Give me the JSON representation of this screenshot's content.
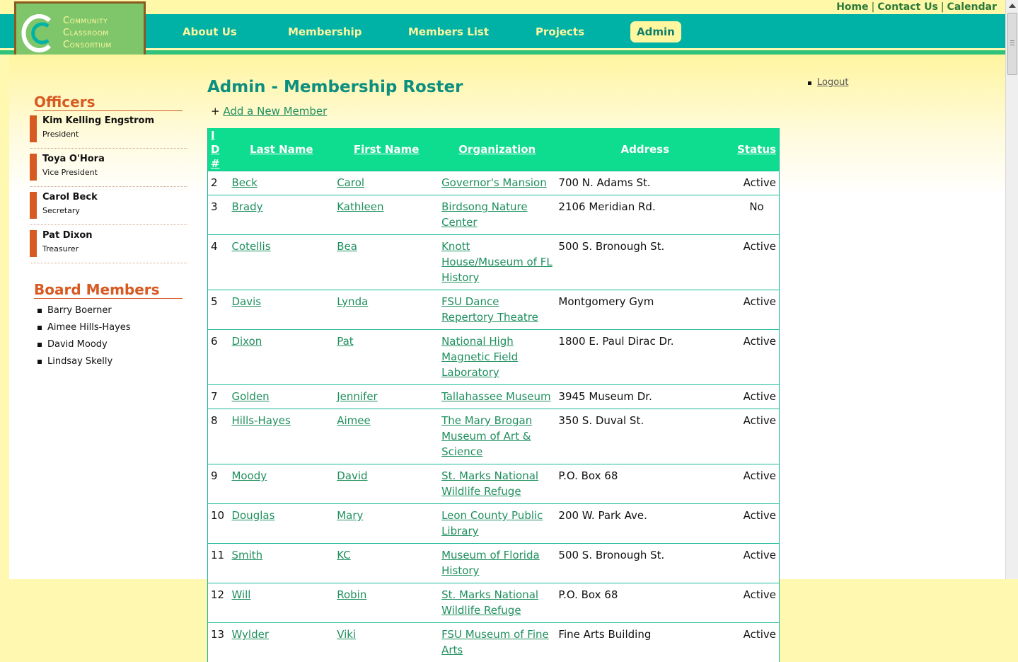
{
  "top_links": [
    "Home",
    "Contact Us",
    "Calendar"
  ],
  "logo": {
    "line1": "Community",
    "line2": "Classroom",
    "line3": "Consortium"
  },
  "nav": [
    {
      "label": "About Us"
    },
    {
      "label": "Membership"
    },
    {
      "label": "Members List"
    },
    {
      "label": "Projects"
    },
    {
      "label": "Admin",
      "active": true
    }
  ],
  "sidebar": {
    "officers_heading": "Officers",
    "officers": [
      {
        "name": "Kim Kelling Engstrom",
        "role": "President"
      },
      {
        "name": "Toya O'Hora",
        "role": "Vice President"
      },
      {
        "name": "Carol Beck",
        "role": "Secretary"
      },
      {
        "name": "Pat Dixon",
        "role": "Treasurer"
      }
    ],
    "board_heading": "Board Members",
    "board": [
      "Barry Boerner",
      "Aimee Hills-Hayes",
      "David Moody",
      "Lindsay Skelly"
    ]
  },
  "content": {
    "title": "Admin - Membership Roster",
    "add_prefix": "+",
    "add_link": "Add a New Member",
    "logout": "Logout"
  },
  "table": {
    "headers": {
      "id": "ID #",
      "last": "Last Name",
      "first": "First Name",
      "org": "Organization",
      "address": "Address",
      "status": "Status"
    },
    "rows": [
      {
        "id": "2",
        "last": "Beck",
        "first": "Carol",
        "org": "Governor's Mansion",
        "address": "700 N. Adams St.",
        "status": "Active"
      },
      {
        "id": "3",
        "last": "Brady",
        "first": "Kathleen",
        "org": "Birdsong Nature Center",
        "address": "2106 Meridian Rd.",
        "status": "No"
      },
      {
        "id": "4",
        "last": "Cotellis",
        "first": "Bea",
        "org": "Knott House/Museum of FL History",
        "address": "500 S. Bronough St.",
        "status": "Active"
      },
      {
        "id": "5",
        "last": "Davis",
        "first": "Lynda",
        "org": "FSU Dance Repertory Theatre",
        "address": "Montgomery Gym",
        "status": "Active"
      },
      {
        "id": "6",
        "last": "Dixon",
        "first": "Pat",
        "org": "National High Magnetic Field Laboratory",
        "address": "1800 E. Paul Dirac Dr.",
        "status": "Active"
      },
      {
        "id": "7",
        "last": "Golden",
        "first": "Jennifer",
        "org": "Tallahassee Museum",
        "address": "3945 Museum Dr.",
        "status": "Active"
      },
      {
        "id": "8",
        "last": "Hills-Hayes",
        "first": "Aimee",
        "org": "The Mary Brogan Museum of Art & Science",
        "address": "350 S. Duval St.",
        "status": "Active"
      },
      {
        "id": "9",
        "last": "Moody",
        "first": "David",
        "org": "St. Marks National Wildlife Refuge",
        "address": "P.O. Box 68",
        "status": "Active"
      },
      {
        "id": "10",
        "last": "Douglas",
        "first": "Mary",
        "org": "Leon County Public Library",
        "address": "200 W. Park Ave.",
        "status": "Active"
      },
      {
        "id": "11",
        "last": "Smith",
        "first": "KC",
        "org": "Museum of Florida History",
        "address": "500 S. Bronough St.",
        "status": "Active"
      },
      {
        "id": "12",
        "last": "Will",
        "first": "Robin",
        "org": "St. Marks National Wildlife Refuge",
        "address": "P.O. Box 68",
        "status": "Active"
      },
      {
        "id": "13",
        "last": "Wylder",
        "first": "Viki",
        "org": "FSU Museum of Fine Arts",
        "address": "Fine Arts Building",
        "status": "Active"
      }
    ]
  }
}
